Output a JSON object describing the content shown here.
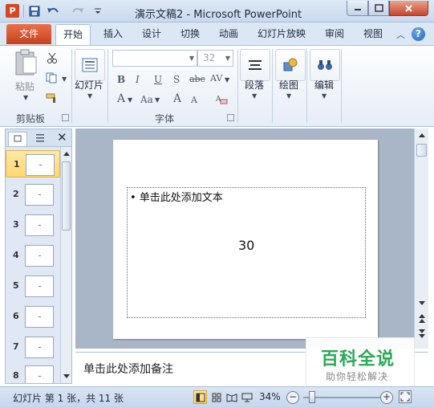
{
  "titlebar": {
    "app_icon_letter": "P",
    "title": "演示文稿2 - Microsoft PowerPoint"
  },
  "tabs": {
    "file": "文件",
    "items": [
      "开始",
      "插入",
      "设计",
      "切换",
      "动画",
      "幻灯片放映",
      "审阅",
      "视图"
    ],
    "active_index": 0,
    "help": "?"
  },
  "ribbon": {
    "clipboard": {
      "paste": "粘贴",
      "group": "剪贴板"
    },
    "slides": {
      "button": "幻灯片"
    },
    "font": {
      "group": "字体",
      "font_name": "",
      "font_size": "32",
      "bold": "B",
      "italic": "I",
      "underline": "U",
      "shadow": "S",
      "strike": "abc",
      "spacing": "AV",
      "color": "A",
      "case": "Aa",
      "grow": "A",
      "shrink": "A"
    },
    "paragraph": {
      "button": "段落"
    },
    "drawing": {
      "button": "绘图"
    },
    "editing": {
      "button": "编辑"
    }
  },
  "slide_pane": {
    "slides": [
      {
        "num": "1",
        "selected": true
      },
      {
        "num": "2",
        "selected": false
      },
      {
        "num": "3",
        "selected": false
      },
      {
        "num": "4",
        "selected": false
      },
      {
        "num": "5",
        "selected": false
      },
      {
        "num": "6",
        "selected": false
      },
      {
        "num": "7",
        "selected": false
      },
      {
        "num": "8",
        "selected": false
      }
    ]
  },
  "slide": {
    "bullet_placeholder": "• 单击此处添加文本",
    "number_text": "30"
  },
  "notes": {
    "placeholder": "单击此处添加备注"
  },
  "watermark": {
    "title": "百科全说",
    "subtitle": "助你轻松解决"
  },
  "statusbar": {
    "slide_info": "幻灯片 第 1 张，共 11 张",
    "zoom": "34%",
    "zoom_minus": "−",
    "zoom_plus": "+"
  },
  "colors": {
    "file_tab": "#c6421f",
    "accent": "#2565b4",
    "watermark_green": "#2aa855"
  }
}
